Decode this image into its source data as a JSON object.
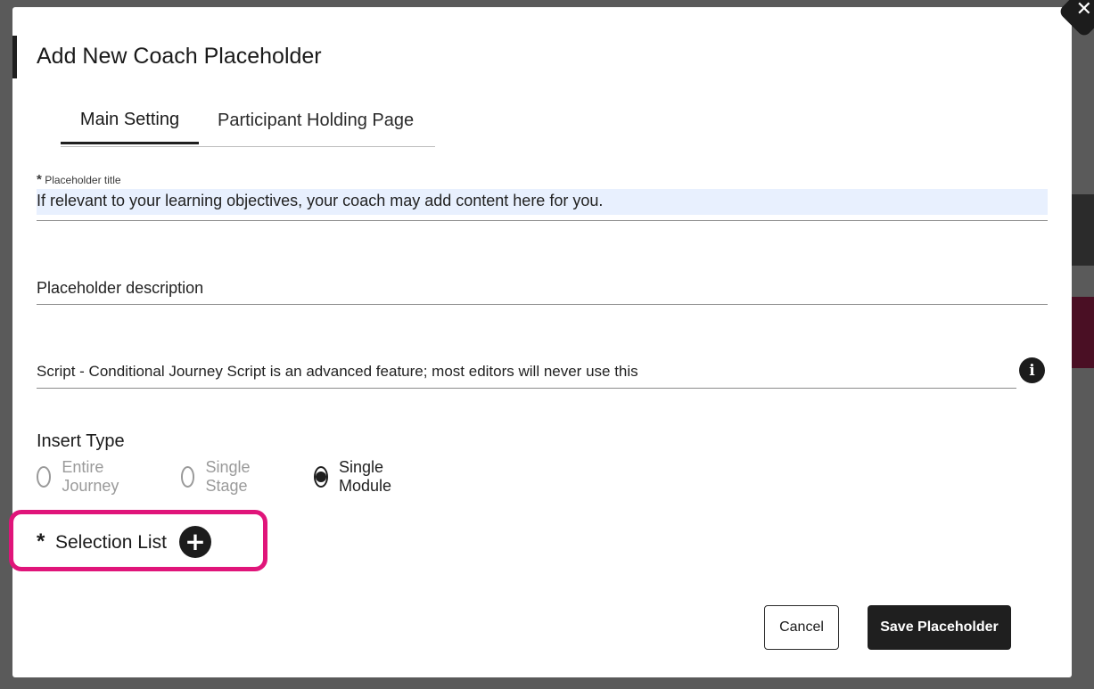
{
  "dialog": {
    "title": "Add New Coach Placeholder",
    "close_icon": "close-icon"
  },
  "tabs": [
    {
      "label": "Main Setting",
      "active": true
    },
    {
      "label": "Participant Holding Page",
      "active": false
    }
  ],
  "form": {
    "title_field": {
      "required_mark": "*",
      "label": "Placeholder title",
      "value": "If relevant to your learning objectives, your coach may add content here for you."
    },
    "description_field": {
      "placeholder": "Placeholder description",
      "value": ""
    },
    "script_field": {
      "placeholder": "Script - Conditional Journey Script is an advanced feature; most editors will never use this",
      "value": "",
      "info_icon": "info-icon"
    },
    "insert_type": {
      "label": "Insert Type",
      "options": [
        {
          "label": "Entire Journey",
          "selected": false,
          "disabled": true
        },
        {
          "label": "Single Stage",
          "selected": false,
          "disabled": true
        },
        {
          "label": "Single Module",
          "selected": true,
          "disabled": false
        }
      ]
    },
    "selection_list": {
      "required_mark": "*",
      "label": "Selection List",
      "add_icon": "plus-circle-icon",
      "highlight_color": "#e0157a"
    }
  },
  "actions": {
    "cancel_label": "Cancel",
    "save_label": "Save Placeholder"
  },
  "colors": {
    "primary": "#1f1f1f",
    "autofill": "#e8f0fe",
    "highlight": "#e0157a"
  }
}
